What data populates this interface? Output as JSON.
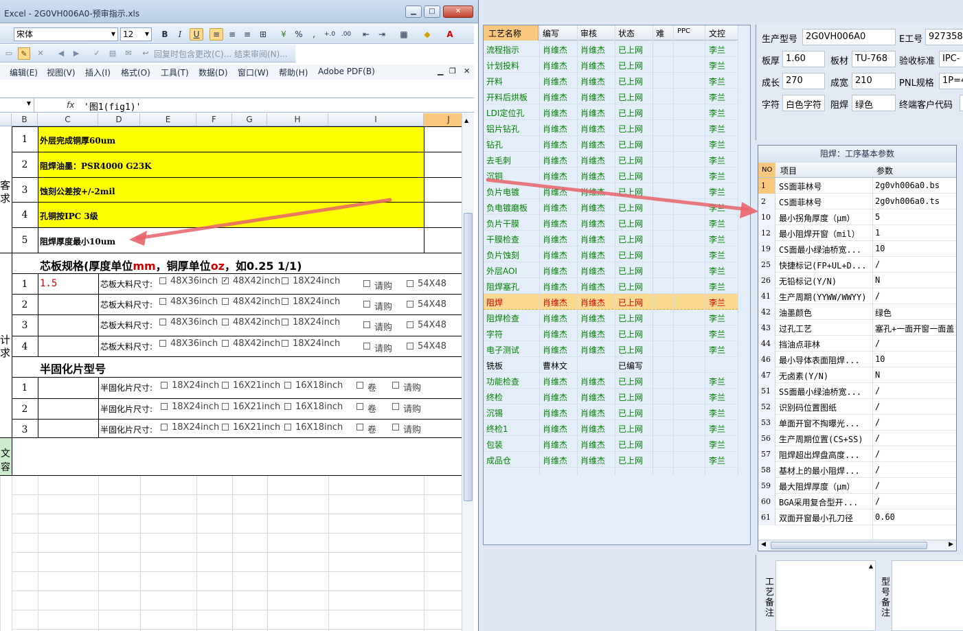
{
  "excel": {
    "title": "Excel - 2G0VH006A0-预审指示.xls",
    "font_name": "宋体",
    "font_size": "12",
    "review_bar_text": "回复时包含更改(C)...  结束审阅(N)...",
    "menus": [
      "编辑(E)",
      "视图(V)",
      "插入(I)",
      "格式(O)",
      "工具(T)",
      "数据(D)",
      "窗口(W)",
      "帮助(H)",
      "Adobe PDF(B)"
    ],
    "formula": "'图1(fig1)'",
    "columns": [
      "B",
      "C",
      "D",
      "E",
      "F",
      "G",
      "H",
      "I",
      "J"
    ],
    "notes": [
      {
        "no": "1",
        "text": "外层完成铜厚60um"
      },
      {
        "no": "2",
        "text": "阻焊油墨：PSR4000 G23K"
      },
      {
        "no": "3",
        "text": "蚀刻公差按+/-2mil"
      },
      {
        "no": "4",
        "text": "孔铜按IPC 3级"
      },
      {
        "no": "5",
        "text": "阻焊厚度最小10um"
      }
    ],
    "side_labels": {
      "a1": "客",
      "a2": "求",
      "b1": "计",
      "b2": "求",
      "c1": "文",
      "c2": "容"
    },
    "core_header": {
      "p1": "芯板规格(厚度单位",
      "u1": "mm",
      "p2": "，铜厚单位",
      "u2": "oz",
      "p3": "，如0.25 1/1)"
    },
    "core_rows": [
      {
        "no": "1",
        "value": "1.5"
      },
      {
        "no": "2",
        "value": ""
      },
      {
        "no": "3",
        "value": ""
      },
      {
        "no": "4",
        "value": ""
      }
    ],
    "core_label": "芯板大料尺寸:",
    "core_opts": [
      "48X36inch",
      "48X42inch",
      "18X24inch",
      "请购",
      "54X48"
    ],
    "pp_header": "半固化片型号",
    "pp_rows": [
      "1",
      "2",
      "3"
    ],
    "pp_label": "半固化片尺寸:",
    "pp_opts": [
      "18X24inch",
      "16X21inch",
      "16X18inch",
      "卷",
      "请购"
    ]
  },
  "process": {
    "headers": [
      "工艺名称",
      "编写",
      "审核",
      "状态",
      "难",
      "PPC",
      "文控"
    ],
    "rows": [
      {
        "name": "流程指示",
        "writer": "肖维杰",
        "reviewer": "肖维杰",
        "status": "已上网",
        "dc": "李兰"
      },
      {
        "name": "计划投料",
        "writer": "肖维杰",
        "reviewer": "肖维杰",
        "status": "已上网",
        "dc": "李兰"
      },
      {
        "name": "开料",
        "writer": "肖维杰",
        "reviewer": "肖维杰",
        "status": "已上网",
        "dc": "李兰"
      },
      {
        "name": "开料后烘板",
        "writer": "肖维杰",
        "reviewer": "肖维杰",
        "status": "已上网",
        "dc": "李兰"
      },
      {
        "name": "LDI定位孔",
        "writer": "肖维杰",
        "reviewer": "肖维杰",
        "status": "已上网",
        "dc": "李兰"
      },
      {
        "name": "铝片钻孔",
        "writer": "肖维杰",
        "reviewer": "肖维杰",
        "status": "已上网",
        "dc": "李兰"
      },
      {
        "name": "钻孔",
        "writer": "肖维杰",
        "reviewer": "肖维杰",
        "status": "已上网",
        "dc": "李兰"
      },
      {
        "name": "去毛刺",
        "writer": "肖维杰",
        "reviewer": "肖维杰",
        "status": "已上网",
        "dc": "李兰"
      },
      {
        "name": "沉铜",
        "writer": "肖维杰",
        "reviewer": "肖维杰",
        "status": "已上网",
        "dc": "李兰"
      },
      {
        "name": "负片电镀",
        "writer": "肖维杰",
        "reviewer": "肖维杰",
        "status": "已上网",
        "dc": "李兰"
      },
      {
        "name": "负电镀磨板",
        "writer": "肖维杰",
        "reviewer": "肖维杰",
        "status": "已上网",
        "dc": "李兰"
      },
      {
        "name": "负片干膜",
        "writer": "肖维杰",
        "reviewer": "肖维杰",
        "status": "已上网",
        "dc": "李兰"
      },
      {
        "name": "干膜检查",
        "writer": "肖维杰",
        "reviewer": "肖维杰",
        "status": "已上网",
        "dc": "李兰"
      },
      {
        "name": "负片蚀刻",
        "writer": "肖维杰",
        "reviewer": "肖维杰",
        "status": "已上网",
        "dc": "李兰"
      },
      {
        "name": "外层AOI",
        "writer": "肖维杰",
        "reviewer": "肖维杰",
        "status": "已上网",
        "dc": "李兰"
      },
      {
        "name": "阻焊塞孔",
        "writer": "肖维杰",
        "reviewer": "肖维杰",
        "status": "已上网",
        "dc": "李兰"
      },
      {
        "name": "阻焊",
        "writer": "肖维杰",
        "reviewer": "肖维杰",
        "status": "已上网",
        "dc": "李兰"
      },
      {
        "name": "阻焊检查",
        "writer": "肖维杰",
        "reviewer": "肖维杰",
        "status": "已上网",
        "dc": "李兰"
      },
      {
        "name": "字符",
        "writer": "肖维杰",
        "reviewer": "肖维杰",
        "status": "已上网",
        "dc": "李兰"
      },
      {
        "name": "电子测试",
        "writer": "肖维杰",
        "reviewer": "肖维杰",
        "status": "已上网",
        "dc": "李兰"
      },
      {
        "name": "铣板",
        "writer": "曹林文",
        "reviewer": "",
        "status": "已编写",
        "dc": ""
      },
      {
        "name": "功能检查",
        "writer": "肖维杰",
        "reviewer": "肖维杰",
        "status": "已上网",
        "dc": "李兰"
      },
      {
        "name": "终检",
        "writer": "肖维杰",
        "reviewer": "肖维杰",
        "status": "已上网",
        "dc": "李兰"
      },
      {
        "name": "沉锡",
        "writer": "肖维杰",
        "reviewer": "肖维杰",
        "status": "已上网",
        "dc": "李兰"
      },
      {
        "name": "终检1",
        "writer": "肖维杰",
        "reviewer": "肖维杰",
        "status": "已上网",
        "dc": "李兰"
      },
      {
        "name": "包装",
        "writer": "肖维杰",
        "reviewer": "肖维杰",
        "status": "已上网",
        "dc": "李兰"
      },
      {
        "name": "成品仓",
        "writer": "肖维杰",
        "reviewer": "肖维杰",
        "status": "已上网",
        "dc": "李兰"
      }
    ],
    "selected_row": "阻焊",
    "plain_row": "铣板"
  },
  "info": {
    "model_label": "生产型号",
    "model_value": "2G0VH006A0",
    "eng_label": "E工号",
    "eng_value": "927358",
    "thick_label": "板厚",
    "thick_value": "1.60",
    "mat_label": "板材",
    "mat_value": "TU-768",
    "std_label": "验收标准",
    "std_value": "IPC-",
    "len_label": "成长",
    "len_value": "270",
    "wid_label": "成宽",
    "wid_value": "210",
    "pnl_label": "PNL规格",
    "pnl_value": "1P=4",
    "char_label": "字符",
    "char_value": "白色字符",
    "mask_label": "阻焊",
    "mask_value": "绿色",
    "cust_label": "终端客户代码"
  },
  "params": {
    "title": "阻焊：工序基本参数",
    "headers": [
      "NO",
      "项目",
      "参数"
    ],
    "rows": [
      {
        "no": "1",
        "item": "SS面菲林号",
        "value": "2g0vh006a0.bs"
      },
      {
        "no": "2",
        "item": "CS面菲林号",
        "value": "2g0vh006a0.ts"
      },
      {
        "no": "10",
        "item": "最小拐角厚度（μm）",
        "value": "5"
      },
      {
        "no": "12",
        "item": "最小阻焊开窗（mil）",
        "value": "1"
      },
      {
        "no": "19",
        "item": "CS面最小绿油桥宽...",
        "value": "10"
      },
      {
        "no": "25",
        "item": "快捷标记(FP+UL+D...",
        "value": "/"
      },
      {
        "no": "26",
        "item": "无铅标记(Y/N)",
        "value": "N"
      },
      {
        "no": "41",
        "item": "生产周期(YYWW/WWYY)",
        "value": "/"
      },
      {
        "no": "42",
        "item": "油墨颜色",
        "value": "绿色"
      },
      {
        "no": "43",
        "item": "过孔工艺",
        "value": "塞孔+一面开窗一面盖"
      },
      {
        "no": "44",
        "item": "挡油点菲林",
        "value": "/"
      },
      {
        "no": "46",
        "item": "最小导体表面阻焊...",
        "value": "10"
      },
      {
        "no": "47",
        "item": "无卤素(Y/N)",
        "value": "N"
      },
      {
        "no": "51",
        "item": "SS面最小绿油桥宽...",
        "value": "/"
      },
      {
        "no": "52",
        "item": "识别码位置图纸",
        "value": "/"
      },
      {
        "no": "53",
        "item": "单面开窗不掏曝光...",
        "value": "/"
      },
      {
        "no": "56",
        "item": "生产周期位置(CS+SS)",
        "value": "/"
      },
      {
        "no": "57",
        "item": "阻焊超出焊盘高度...",
        "value": "/"
      },
      {
        "no": "58",
        "item": "基材上的最小阻焊...",
        "value": "/"
      },
      {
        "no": "59",
        "item": "最大阻焊厚度（μm）",
        "value": "/"
      },
      {
        "no": "60",
        "item": "BGA采用复合型开...",
        "value": "/"
      },
      {
        "no": "61",
        "item": "双面开窗最小孔刀径",
        "value": "0.60"
      }
    ]
  },
  "bottom": {
    "remark1": "工艺备注",
    "remark2": "型号备注"
  }
}
